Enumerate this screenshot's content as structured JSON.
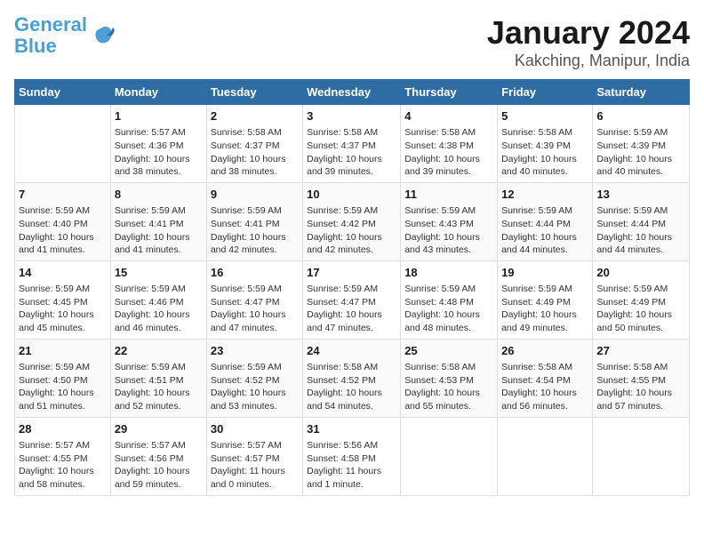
{
  "header": {
    "logo_line1": "General",
    "logo_line2": "Blue",
    "month": "January 2024",
    "location": "Kakching, Manipur, India"
  },
  "weekdays": [
    "Sunday",
    "Monday",
    "Tuesday",
    "Wednesday",
    "Thursday",
    "Friday",
    "Saturday"
  ],
  "rows": [
    [
      {
        "day": "",
        "info": ""
      },
      {
        "day": "1",
        "info": "Sunrise: 5:57 AM\nSunset: 4:36 PM\nDaylight: 10 hours\nand 38 minutes."
      },
      {
        "day": "2",
        "info": "Sunrise: 5:58 AM\nSunset: 4:37 PM\nDaylight: 10 hours\nand 38 minutes."
      },
      {
        "day": "3",
        "info": "Sunrise: 5:58 AM\nSunset: 4:37 PM\nDaylight: 10 hours\nand 39 minutes."
      },
      {
        "day": "4",
        "info": "Sunrise: 5:58 AM\nSunset: 4:38 PM\nDaylight: 10 hours\nand 39 minutes."
      },
      {
        "day": "5",
        "info": "Sunrise: 5:58 AM\nSunset: 4:39 PM\nDaylight: 10 hours\nand 40 minutes."
      },
      {
        "day": "6",
        "info": "Sunrise: 5:59 AM\nSunset: 4:39 PM\nDaylight: 10 hours\nand 40 minutes."
      }
    ],
    [
      {
        "day": "7",
        "info": "Sunrise: 5:59 AM\nSunset: 4:40 PM\nDaylight: 10 hours\nand 41 minutes."
      },
      {
        "day": "8",
        "info": "Sunrise: 5:59 AM\nSunset: 4:41 PM\nDaylight: 10 hours\nand 41 minutes."
      },
      {
        "day": "9",
        "info": "Sunrise: 5:59 AM\nSunset: 4:41 PM\nDaylight: 10 hours\nand 42 minutes."
      },
      {
        "day": "10",
        "info": "Sunrise: 5:59 AM\nSunset: 4:42 PM\nDaylight: 10 hours\nand 42 minutes."
      },
      {
        "day": "11",
        "info": "Sunrise: 5:59 AM\nSunset: 4:43 PM\nDaylight: 10 hours\nand 43 minutes."
      },
      {
        "day": "12",
        "info": "Sunrise: 5:59 AM\nSunset: 4:44 PM\nDaylight: 10 hours\nand 44 minutes."
      },
      {
        "day": "13",
        "info": "Sunrise: 5:59 AM\nSunset: 4:44 PM\nDaylight: 10 hours\nand 44 minutes."
      }
    ],
    [
      {
        "day": "14",
        "info": "Sunrise: 5:59 AM\nSunset: 4:45 PM\nDaylight: 10 hours\nand 45 minutes."
      },
      {
        "day": "15",
        "info": "Sunrise: 5:59 AM\nSunset: 4:46 PM\nDaylight: 10 hours\nand 46 minutes."
      },
      {
        "day": "16",
        "info": "Sunrise: 5:59 AM\nSunset: 4:47 PM\nDaylight: 10 hours\nand 47 minutes."
      },
      {
        "day": "17",
        "info": "Sunrise: 5:59 AM\nSunset: 4:47 PM\nDaylight: 10 hours\nand 47 minutes."
      },
      {
        "day": "18",
        "info": "Sunrise: 5:59 AM\nSunset: 4:48 PM\nDaylight: 10 hours\nand 48 minutes."
      },
      {
        "day": "19",
        "info": "Sunrise: 5:59 AM\nSunset: 4:49 PM\nDaylight: 10 hours\nand 49 minutes."
      },
      {
        "day": "20",
        "info": "Sunrise: 5:59 AM\nSunset: 4:49 PM\nDaylight: 10 hours\nand 50 minutes."
      }
    ],
    [
      {
        "day": "21",
        "info": "Sunrise: 5:59 AM\nSunset: 4:50 PM\nDaylight: 10 hours\nand 51 minutes."
      },
      {
        "day": "22",
        "info": "Sunrise: 5:59 AM\nSunset: 4:51 PM\nDaylight: 10 hours\nand 52 minutes."
      },
      {
        "day": "23",
        "info": "Sunrise: 5:59 AM\nSunset: 4:52 PM\nDaylight: 10 hours\nand 53 minutes."
      },
      {
        "day": "24",
        "info": "Sunrise: 5:58 AM\nSunset: 4:52 PM\nDaylight: 10 hours\nand 54 minutes."
      },
      {
        "day": "25",
        "info": "Sunrise: 5:58 AM\nSunset: 4:53 PM\nDaylight: 10 hours\nand 55 minutes."
      },
      {
        "day": "26",
        "info": "Sunrise: 5:58 AM\nSunset: 4:54 PM\nDaylight: 10 hours\nand 56 minutes."
      },
      {
        "day": "27",
        "info": "Sunrise: 5:58 AM\nSunset: 4:55 PM\nDaylight: 10 hours\nand 57 minutes."
      }
    ],
    [
      {
        "day": "28",
        "info": "Sunrise: 5:57 AM\nSunset: 4:55 PM\nDaylight: 10 hours\nand 58 minutes."
      },
      {
        "day": "29",
        "info": "Sunrise: 5:57 AM\nSunset: 4:56 PM\nDaylight: 10 hours\nand 59 minutes."
      },
      {
        "day": "30",
        "info": "Sunrise: 5:57 AM\nSunset: 4:57 PM\nDaylight: 11 hours\nand 0 minutes."
      },
      {
        "day": "31",
        "info": "Sunrise: 5:56 AM\nSunset: 4:58 PM\nDaylight: 11 hours\nand 1 minute."
      },
      {
        "day": "",
        "info": ""
      },
      {
        "day": "",
        "info": ""
      },
      {
        "day": "",
        "info": ""
      }
    ]
  ]
}
